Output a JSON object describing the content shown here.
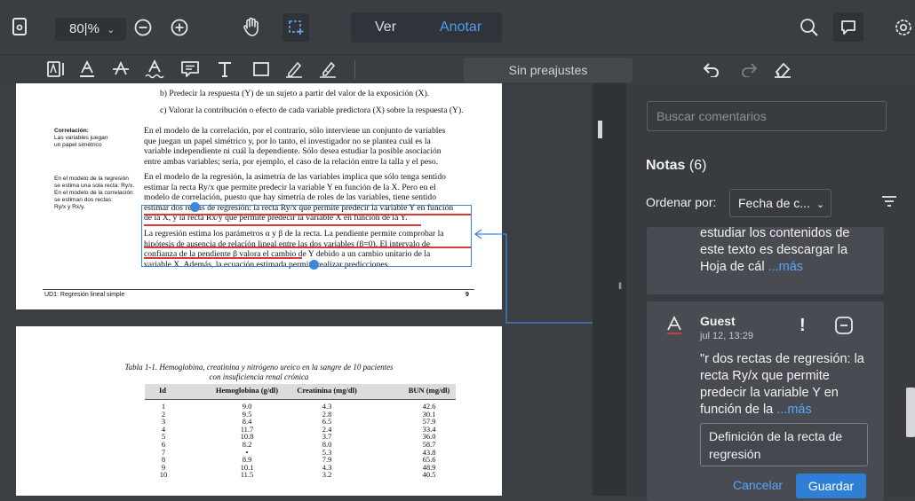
{
  "topbar": {
    "zoom_value": "80|%",
    "mode_view": "Ver",
    "mode_annotate": "Anotar"
  },
  "toolbar": {
    "presets": "Sin preajustes"
  },
  "document": {
    "page1": {
      "line_b": "b) Predecir la respuesta (Y) de un sujeto a partir del valor de la exposición (X).",
      "line_c": "c) Valorar la contribución o efecto de cada variable predictora (X) sobre la respuesta (Y).",
      "side1_title": "Correlación:",
      "side1_l1": "Las variables juegan",
      "side1_l2": "un papel simétrico",
      "side2_l1": "En el modelo de la regresión",
      "side2_l2": "se estima una sola recta: Ry/x.",
      "side2_l3": "En el modelo de la correlación",
      "side2_l4": "se estiman dos rectas:",
      "side2_l5": "Ry/x y Rx/y.",
      "p1_l1": "En el modelo de la correlación, por el contrario, sólo interviene un conjunto de variables",
      "p1_l2": "que juegan un papel simétrico y, por lo tanto, el investigador no se plantea cuál es la",
      "p1_l3": "variable independiente ni cuál la dependiente. Sólo desea estudiar la posible asociación",
      "p1_l4": "entre ambas variables; sería, por ejemplo, el caso de la relación entre la talla y el peso.",
      "p2_l1": "En el modelo de la regresión, la asimetría de las variables implica que sólo tenga sentido",
      "p2_l2": "estimar la recta Ry/x que permite predecir la variable Y en función de la X. Pero en el",
      "p2_l3": "modelo de correlación, puesto que hay simetría de roles de las variables, tiene sentido",
      "p2_l4": "estimar dos rectas de regresión: la recta Ry/x que permite predecir la variable Y en función",
      "p2_l5": "de la X, y la recta Rx/y que permite predecir la variable X en función de la Y.",
      "p3_l1": "La regresión estima los parámetros α y β de la recta. La pendiente permite comprobar la",
      "p3_l2": "hipótesis de ausencia de relación lineal entre las dos variables (β=0). El intervalo de",
      "p3_l3": "confianza de la pendiente β valora el cambio de Y debido a un cambio unitario de la",
      "p3_l4": "variable X. Además, la ecuación estimada permite realizar predicciones.",
      "footer_left": "UD1: Regresión lineal simple",
      "footer_page": "9"
    },
    "page2": {
      "caption_l1": "Tabla 1-1. Hemoglobina, creatinina y nitrógeno ureico en la sangre de 10 pacientes",
      "caption_l2": "con insuficiencia renal crónica",
      "headers": [
        "Id",
        "Hemoglobina (g/dl)",
        "Creatinina (mg/dl)",
        "BUN (mg/dl)"
      ],
      "rows": [
        [
          "1",
          "9.0",
          "4.3",
          "42.6"
        ],
        [
          "2",
          "9.5",
          "2.8",
          "30.1"
        ],
        [
          "3",
          "8.4",
          "6.5",
          "57.9"
        ],
        [
          "4",
          "11.7",
          "2.4",
          "33.4"
        ],
        [
          "5",
          "10.8",
          "3.7",
          "36.0"
        ],
        [
          "6",
          "8.2",
          "8.0",
          "58.7"
        ],
        [
          "7",
          "•",
          "5.3",
          "43.8"
        ],
        [
          "8",
          "8.9",
          "7.9",
          "65.6"
        ],
        [
          "9",
          "10.1",
          "4.3",
          "48.9"
        ],
        [
          "10",
          "11.5",
          "3.2",
          "40.5"
        ]
      ]
    }
  },
  "panel": {
    "search_placeholder": "Buscar comentarios",
    "notes_label": "Notas",
    "notes_count": "(6)",
    "sort_label": "Ordenar por:",
    "sort_value": "Fecha de c...",
    "prev_card": {
      "l1": "estudiar los contenidos de",
      "l2": "este texto es descargar la",
      "l3": "Hoja de cál",
      "more": "...más"
    },
    "active_card": {
      "author": "Guest",
      "time": "jul 12, 13:29",
      "q1": "\"r dos rectas de regresión: la",
      "q2": "recta Ry/x que permite",
      "q3": "predecir la variable Y en",
      "q4": "función de la",
      "more": "...más",
      "input_l1": "Definición de la recta de",
      "input_l2": "regresión",
      "cancel": "Cancelar",
      "save": "Guardar"
    }
  },
  "colors": {
    "accent": "#2f7fd6",
    "selection": "#3b87d9",
    "underline": "#d63b3b"
  }
}
